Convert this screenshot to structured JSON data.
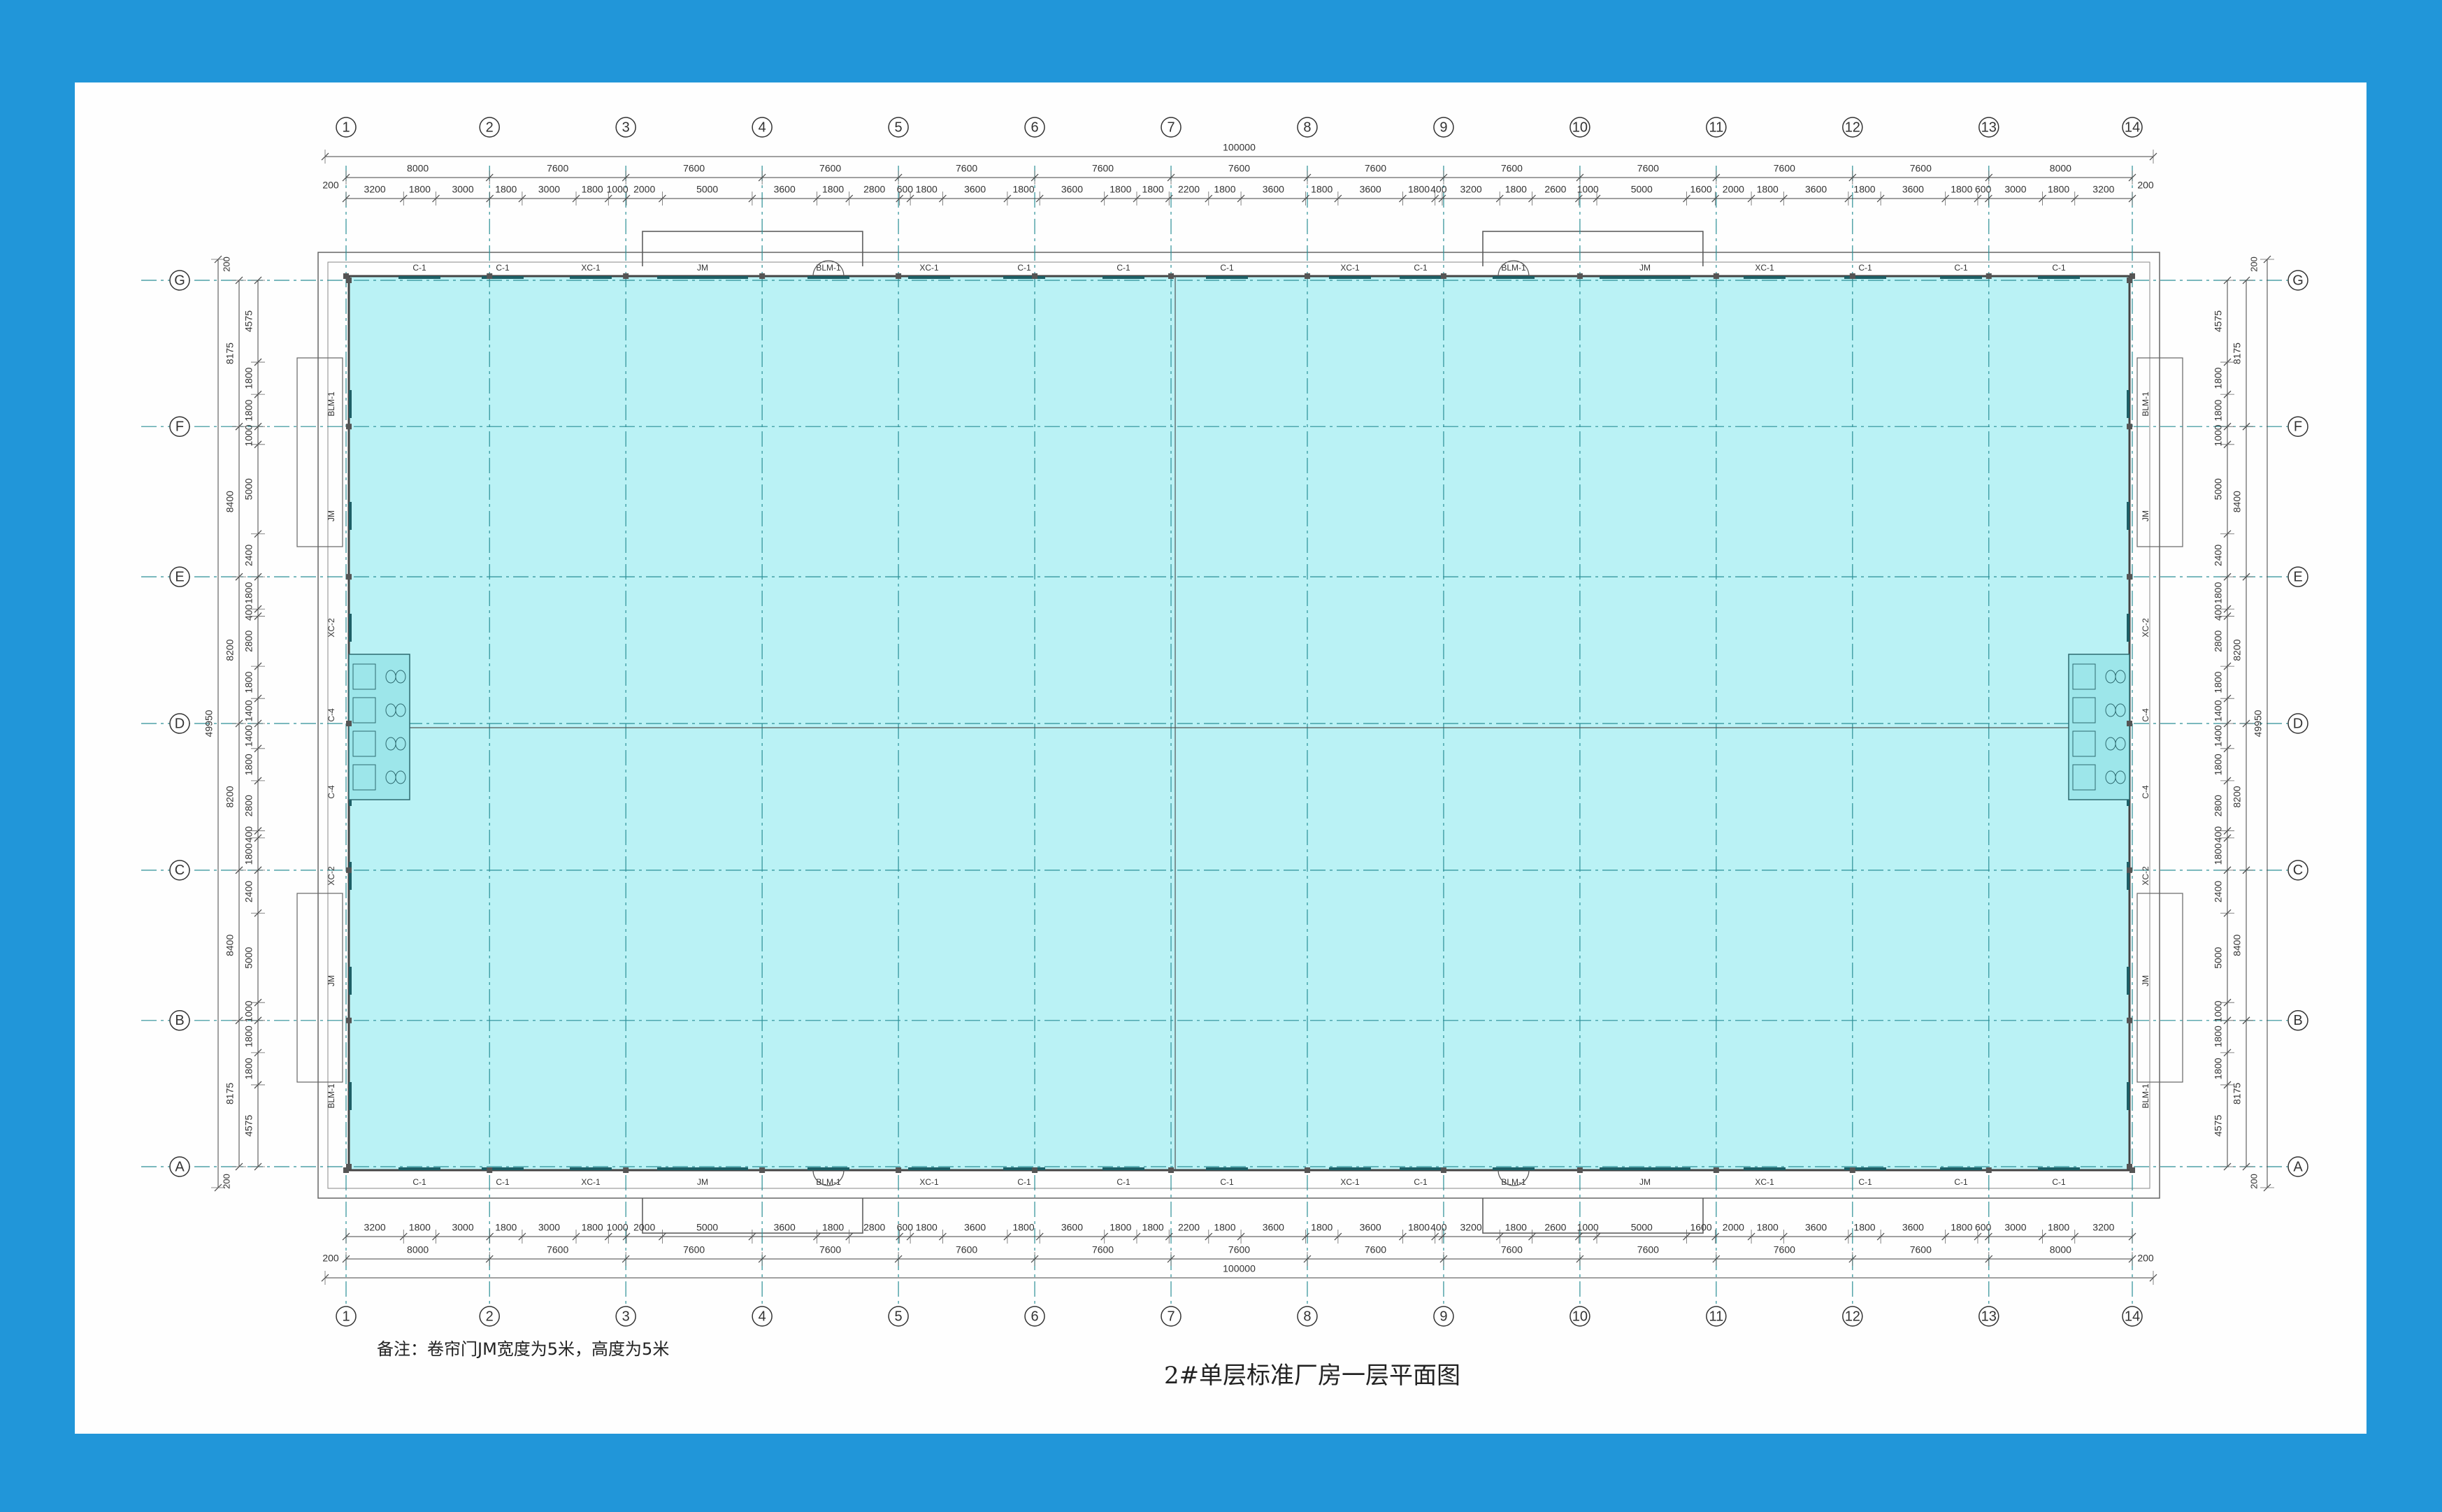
{
  "theme": {
    "frame": "#2196d9",
    "sheet": "#fefefe",
    "floor": "#baf2f5",
    "line": "#333333",
    "grid": "#2b8f96"
  },
  "drawing": {
    "title": "2#单层标准厂房一层平面图",
    "note": "备注：卷帘门JM宽度为5米，高度为5米",
    "overall_length": "100000",
    "overall_width": "49950",
    "end_offset": "200"
  },
  "axes_x": [
    {
      "id": "1",
      "span": "8000"
    },
    {
      "id": "2",
      "span": "7600"
    },
    {
      "id": "3",
      "span": "7600"
    },
    {
      "id": "4",
      "span": "7600"
    },
    {
      "id": "5",
      "span": "7600"
    },
    {
      "id": "6",
      "span": "7600"
    },
    {
      "id": "7",
      "span": "7600"
    },
    {
      "id": "8",
      "span": "7600"
    },
    {
      "id": "9",
      "span": "7600"
    },
    {
      "id": "10",
      "span": "7600"
    },
    {
      "id": "11",
      "span": "7600"
    },
    {
      "id": "12",
      "span": "7600"
    },
    {
      "id": "13",
      "span": "8000"
    },
    {
      "id": "14",
      "span": ""
    }
  ],
  "axes_y": [
    {
      "id": "G",
      "span": "8175"
    },
    {
      "id": "F",
      "span": "8400"
    },
    {
      "id": "E",
      "span": "8200"
    },
    {
      "id": "D",
      "span": "8200"
    },
    {
      "id": "C",
      "span": "8400"
    },
    {
      "id": "B",
      "span": "8175"
    },
    {
      "id": "A",
      "span": ""
    }
  ],
  "dims_x_detail": [
    "3200",
    "1800",
    "3000",
    "1800",
    "3000",
    "1800",
    "1000",
    "2000",
    "5000",
    "3600",
    "1800",
    "2800",
    "600",
    "1800",
    "3600",
    "1800",
    "3600",
    "1800",
    "1800",
    "2200",
    "1800",
    "3600",
    "1800",
    "3600",
    "1800",
    "400",
    "3200",
    "1800",
    "2600",
    "1000",
    "5000",
    "1600",
    "2000",
    "1800",
    "3600",
    "1800",
    "3600",
    "1800",
    "600",
    "3000",
    "1800",
    "3200"
  ],
  "dims_y_detail": [
    "4575",
    "1800",
    "1800",
    "1000",
    "5000",
    "2400",
    "1800",
    "400",
    "2800",
    "1800",
    "1400",
    "1400",
    "1800",
    "2800",
    "400",
    "1800",
    "2400",
    "5000",
    "1000",
    "1800",
    "1800",
    "4575"
  ],
  "door_labels": {
    "window": "C-1",
    "window_alt": "XC-1",
    "side_window": "XC-2",
    "side_window_alt": "C-4",
    "rolling_door": "JM",
    "exit_door": "BLM-1"
  }
}
